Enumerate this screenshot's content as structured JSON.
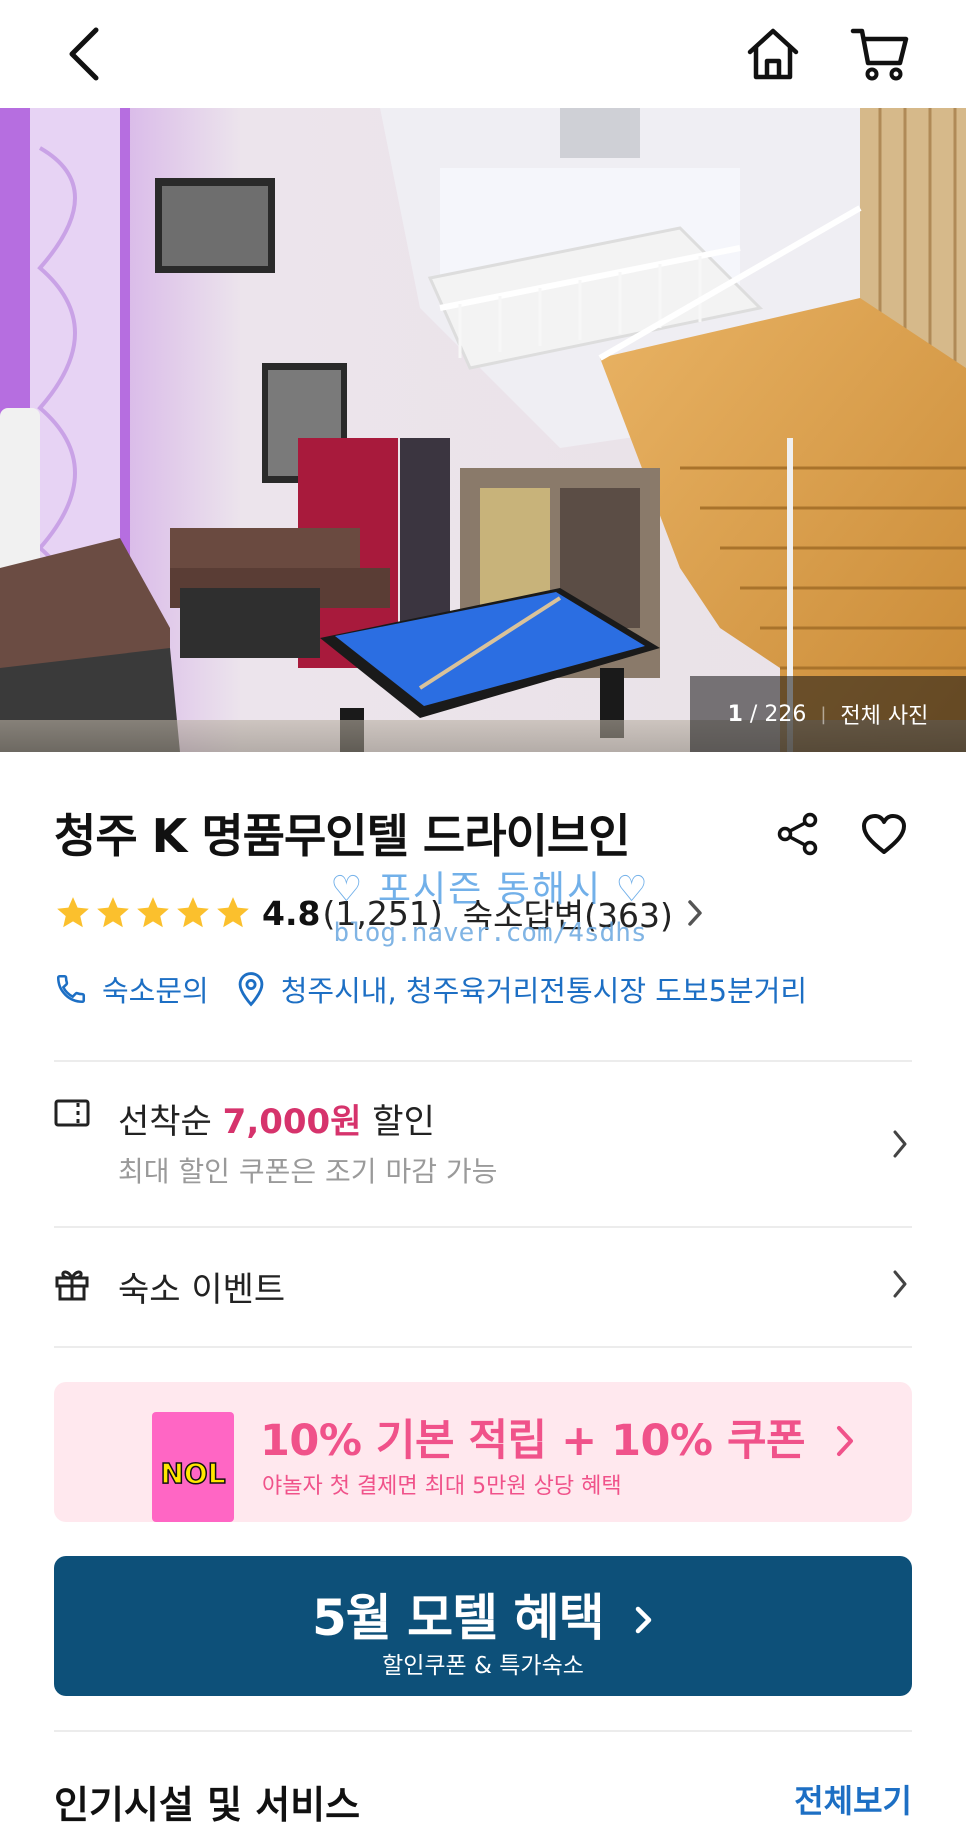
{
  "header": {
    "back_icon": "back-arrow-icon",
    "home_icon": "home-icon",
    "cart_icon": "cart-icon"
  },
  "gallery": {
    "current": "1",
    "separator": "/",
    "total": "226",
    "all_photos_label": "전체 사진"
  },
  "hotel": {
    "name": "청주 K 명품무인텔 드라이브인",
    "rating": "4.8",
    "rating_stars": 5,
    "review_count": "(1,251)",
    "host_reply": "숙소답변(363)",
    "inquiry_label": "숙소문의",
    "location": "청주시내, 청주육거리전통시장 도보5분거리"
  },
  "watermark": {
    "line1": "♡ 포시즌 동해시 ♡",
    "line2": "blog.naver.com/4sdhs"
  },
  "coupon": {
    "prefix": "선착순",
    "amount": "7,000원",
    "suffix": "할인",
    "note": "최대 할인 쿠폰은 조기 마감 가능"
  },
  "event": {
    "label": "숙소 이벤트"
  },
  "promo": {
    "headline": "10% 기본 적립 + 10% 쿠폰",
    "subline": "야놀자 첫 결제면 최대 5만원 상당 혜택",
    "card_logo": "NOL"
  },
  "banner": {
    "headline": "5월 모텔 혜택",
    "subline": "할인쿠폰 & 특가숙소"
  },
  "facilities": {
    "title": "인기시설 및 서비스",
    "see_all": "전체보기"
  },
  "colors": {
    "accent_blue": "#1d6fc4",
    "coupon_pink": "#d6336c",
    "promo_pink": "#f0528a",
    "promo_bg": "#ffe8ee",
    "banner_bg": "#0d5079",
    "star": "#fbc02d"
  }
}
